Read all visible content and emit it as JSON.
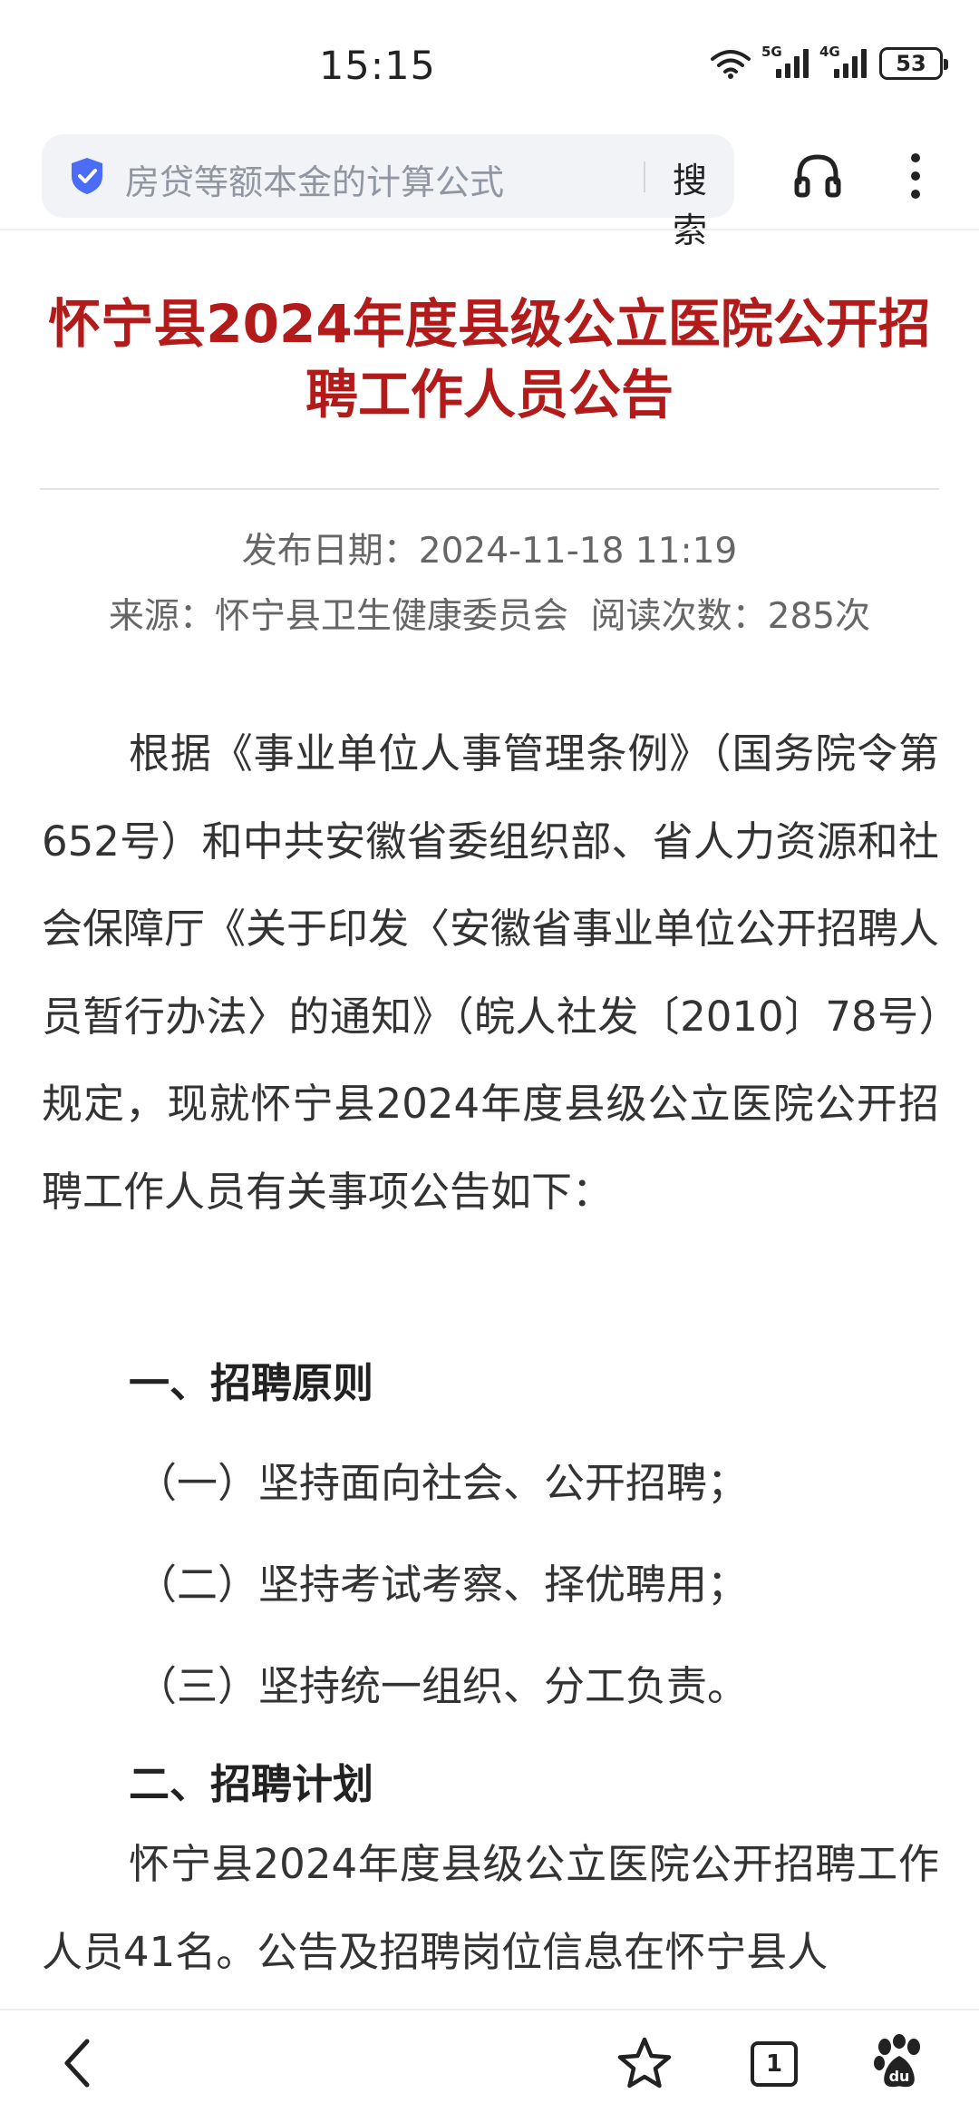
{
  "status_bar": {
    "time": "15:15",
    "network_1": "5G",
    "network_2": "4G",
    "battery": "53"
  },
  "browser": {
    "search_query": "房贷等额本金的计算公式",
    "search_button": "搜索",
    "icons": [
      "shield-icon",
      "headphone-icon",
      "more-icon"
    ]
  },
  "article": {
    "title": "怀宁县2024年度县级公立医院公开招聘工作人员公告",
    "publish_date": "发布日期：2024-11-18 11:19",
    "source_line": "来源：怀宁县卫生健康委员会  阅读次数：285次",
    "paragraph_1": "根据《事业单位人事管理条例》（国务院令第652号）和中共安徽省委组织部、省人力资源和社会保障厅《关于印发〈安徽省事业单位公开招聘人员暂行办法〉的通知》（皖人社发〔2010〕78号）规定，现就怀宁县2024年度县级公立医院公开招聘工作人员有关事项公告如下：",
    "heading_1": "一、招聘原则",
    "principle_1": "（一）坚持面向社会、公开招聘；",
    "principle_2": "（二）坚持考试考察、择优聘用；",
    "principle_3": "（三）坚持统一组织、分工负责。",
    "heading_2": "二、招聘计划",
    "paragraph_2": "怀宁县2024年度县级公立医院公开招聘工作人员41名。公告及招聘岗位信息在怀宁县人"
  },
  "bottom_nav": {
    "tab_count": "1",
    "icons": [
      "back-icon",
      "star-icon",
      "tabs-icon",
      "baidu-paw-icon"
    ]
  },
  "colors": {
    "title_red": "#b31b1b",
    "shield_blue": "#4a6cf7"
  }
}
